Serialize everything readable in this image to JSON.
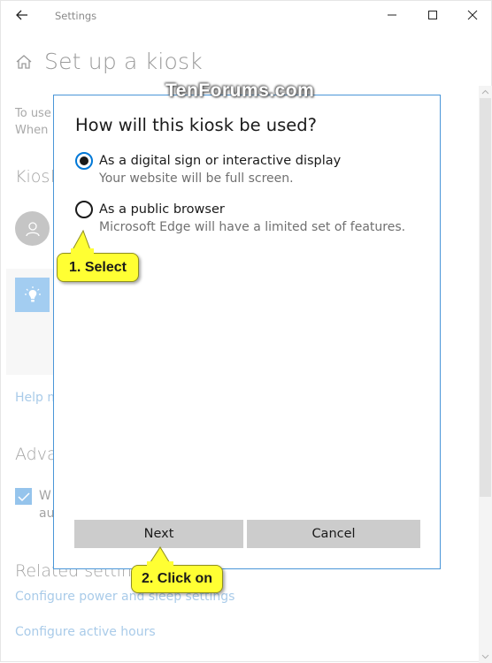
{
  "window": {
    "app_title": "Settings",
    "controls": {
      "minimize": "minimize-icon",
      "maximize": "maximize-icon",
      "close": "close-icon"
    }
  },
  "page": {
    "title": "Set up a kiosk",
    "intro_lines": [
      "To use",
      "When"
    ],
    "kiosk_section_title": "Kiosk",
    "help_link": "Help m",
    "advanced_section_title": "Adva",
    "checkbox": {
      "checked": true,
      "label_lines": [
        "W",
        "au"
      ]
    },
    "related_section_title": "Related settings",
    "links": [
      "Configure power and sleep settings",
      "Configure active hours"
    ]
  },
  "dialog": {
    "title": "How will this kiosk be used?",
    "options": [
      {
        "label": "As a digital sign or interactive display",
        "description": "Your website will be full screen.",
        "selected": true
      },
      {
        "label": "As a public browser",
        "description": "Microsoft Edge will have a limited set of features.",
        "selected": false
      }
    ],
    "buttons": {
      "next": "Next",
      "cancel": "Cancel"
    }
  },
  "annotations": {
    "watermark": "TenForums.com",
    "callout_1": "1. Select",
    "callout_2": "2. Click on"
  },
  "colors": {
    "accent": "#0078d7",
    "dialog_border": "#4a96d8",
    "callout_fill": "#ffff33",
    "link": "#a9cbe9",
    "button_bg": "#cccccc"
  }
}
